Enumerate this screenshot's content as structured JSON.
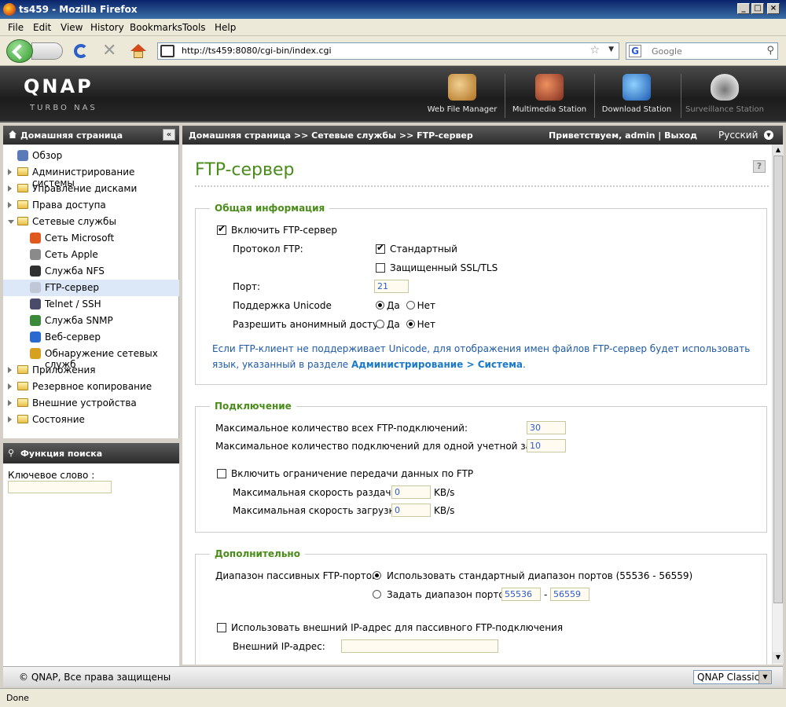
{
  "window": {
    "title": "ts459 - Mozilla Firefox"
  },
  "menu": [
    "File",
    "Edit",
    "View",
    "History",
    "Bookmarks",
    "Tools",
    "Help"
  ],
  "browser": {
    "url": "http://ts459:8080/cgi-bin/index.cgi",
    "search_placeholder": "Google"
  },
  "qnap": {
    "logo": "QNAP",
    "logo_sub": "TURBO NAS",
    "stations": [
      {
        "label": "Web File Manager",
        "icon": "web-file-manager-icon",
        "color": "#d8a040"
      },
      {
        "label": "Multimedia Station",
        "icon": "multimedia-station-icon",
        "color": "#c85030"
      },
      {
        "label": "Download Station",
        "icon": "download-station-icon",
        "color": "#3080d0"
      },
      {
        "label": "Surveillance Station",
        "icon": "surveillance-station-icon",
        "color": "#9a9a9a"
      }
    ]
  },
  "left_header": "Домашняя страница",
  "breadcrumb": "Домашняя страница >> Сетевые службы >> FTP-сервер",
  "greeting": "Приветствуем,  admin | Выход",
  "language": "Русский",
  "tree": [
    {
      "label": "Обзор",
      "level": 1,
      "type": "leaf",
      "icon": "overview-icon",
      "color": "#5a7ab8"
    },
    {
      "label": "Администрирование системы",
      "level": 0,
      "type": "folder"
    },
    {
      "label": "Управление дисками",
      "level": 0,
      "type": "folder"
    },
    {
      "label": "Права доступа",
      "level": 0,
      "type": "folder"
    },
    {
      "label": "Сетевые службы",
      "level": 0,
      "type": "folder",
      "open": true
    },
    {
      "label": "Сеть Microsoft",
      "level": 2,
      "type": "leaf",
      "icon": "windows-icon",
      "color": "#e05a20"
    },
    {
      "label": "Сеть Apple",
      "level": 2,
      "type": "leaf",
      "icon": "apple-icon",
      "color": "#8a8a8a"
    },
    {
      "label": "Служба NFS",
      "level": 2,
      "type": "leaf",
      "icon": "linux-icon",
      "color": "#303030"
    },
    {
      "label": "FTP-сервер",
      "level": 2,
      "type": "leaf",
      "icon": "ftp-icon",
      "color": "#c0c8d8",
      "selected": true
    },
    {
      "label": "Telnet / SSH",
      "level": 2,
      "type": "leaf",
      "icon": "telnet-icon",
      "color": "#4a4a6a"
    },
    {
      "label": "Служба SNMP",
      "level": 2,
      "type": "leaf",
      "icon": "snmp-icon",
      "color": "#3a8a3a"
    },
    {
      "label": "Веб-сервер",
      "level": 2,
      "type": "leaf",
      "icon": "web-server-icon",
      "color": "#2a6ad0"
    },
    {
      "label": "Обнаружение сетевых служб",
      "level": 2,
      "type": "leaf",
      "icon": "discovery-icon",
      "color": "#d8a020"
    },
    {
      "label": "Приложения",
      "level": 0,
      "type": "folder"
    },
    {
      "label": "Резервное копирование",
      "level": 0,
      "type": "folder"
    },
    {
      "label": "Внешние устройства",
      "level": 0,
      "type": "folder"
    },
    {
      "label": "Состояние",
      "level": 0,
      "type": "folder"
    }
  ],
  "search_panel": {
    "title": "Функция поиска",
    "keyword_label": "Ключевое слово :"
  },
  "page": {
    "title": "FTP-сервер"
  },
  "general": {
    "legend": "Общая информация",
    "enable_label": "Включить FTP-сервер",
    "protocol_label": "Протокол FTP:",
    "protocol_standard": "Стандартный",
    "protocol_ssl": "Защищенный SSL/TLS",
    "port_label": "Порт:",
    "port_value": "21",
    "unicode_label": "Поддержка Unicode",
    "anon_label": "Разрешить анонимный доступ",
    "yes": "Да",
    "no": "Нет",
    "note_text": "Если FTP-клиент не поддерживает Unicode, для отображения имен файлов FTP-сервер будет использовать язык, указанный в разделе ",
    "note_link": "Администрирование > Система",
    "note_end": "."
  },
  "connection": {
    "legend": "Подключение",
    "max_all_label": "Максимальное количество всех FTP-подключений:",
    "max_all_value": "30",
    "max_account_label": "Максимальное количество подключений для одной учетной записи:",
    "max_account_value": "10",
    "limit_label": "Включить ограничение передачи данных по FTP",
    "upload_label": "Максимальная скорость раздачи:",
    "upload_value": "0",
    "download_label": "Максимальная скорость загрузки:",
    "download_value": "0",
    "unit": "KB/s"
  },
  "advanced": {
    "legend": "Дополнительно",
    "passive_label": "Диапазон пассивных FTP-портов:",
    "default_range": "Использовать стандартный диапазон портов (55536 - 56559)",
    "custom_range": "Задать диапазон портов:",
    "range_from": "55536",
    "range_sep": "-",
    "range_to": "56559",
    "external_ip_enable": "Использовать внешний IP-адрес для пассивного FTP-подключения",
    "external_ip_label": "Внешний IP-адрес:"
  },
  "footer": {
    "copyright": "© QNAP, Все права защищены",
    "theme": "QNAP Classic"
  },
  "status": "Done"
}
